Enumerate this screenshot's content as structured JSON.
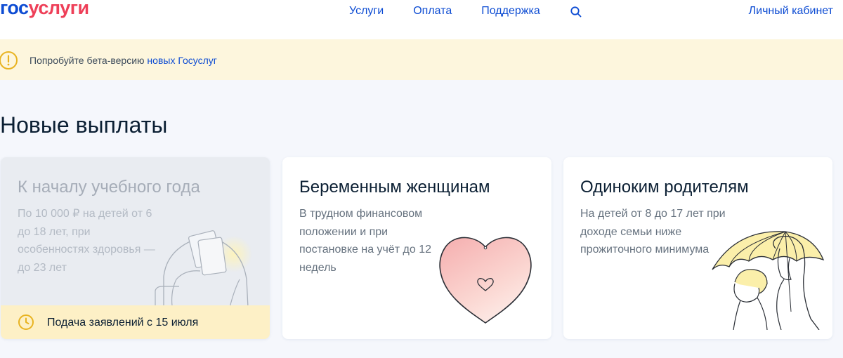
{
  "header": {
    "logo_part1": "гос",
    "logo_part2": "услуги",
    "nav": [
      "Услуги",
      "Оплата",
      "Поддержка"
    ],
    "search_icon": "search-icon",
    "cabinet": "Личный кабинет"
  },
  "banner": {
    "icon": "warning-circle-icon",
    "text": "Попробуйте бета-версию ",
    "link": "новых Госуслуг"
  },
  "section": {
    "title": "Новые выплаты"
  },
  "cards": [
    {
      "title": "К началу учебного года",
      "desc": "По 10 000 ₽ на детей от 6 до 18 лет, при особенностях здоровья — до 23 лет",
      "footer": "Подача заявлений с 15 июля",
      "icon": "backpack-illustration",
      "footer_icon": "clock-icon"
    },
    {
      "title": "Беременным женщинам",
      "desc": "В трудном финансовом положении и при постановке на учёт до 12 недель",
      "icon": "heart-illustration"
    },
    {
      "title": "Одиноким родителям",
      "desc": "На детей от 8 до 17 лет при доходе семьи ниже прожиточного минимума",
      "icon": "umbrella-family-illustration"
    }
  ],
  "colors": {
    "brand_blue": "#0d4cd3",
    "brand_red": "#ee3f58",
    "banner_bg": "#fdf6dd",
    "footer_bg": "#fdf0c6",
    "page_bg": "#f5f7fc"
  }
}
